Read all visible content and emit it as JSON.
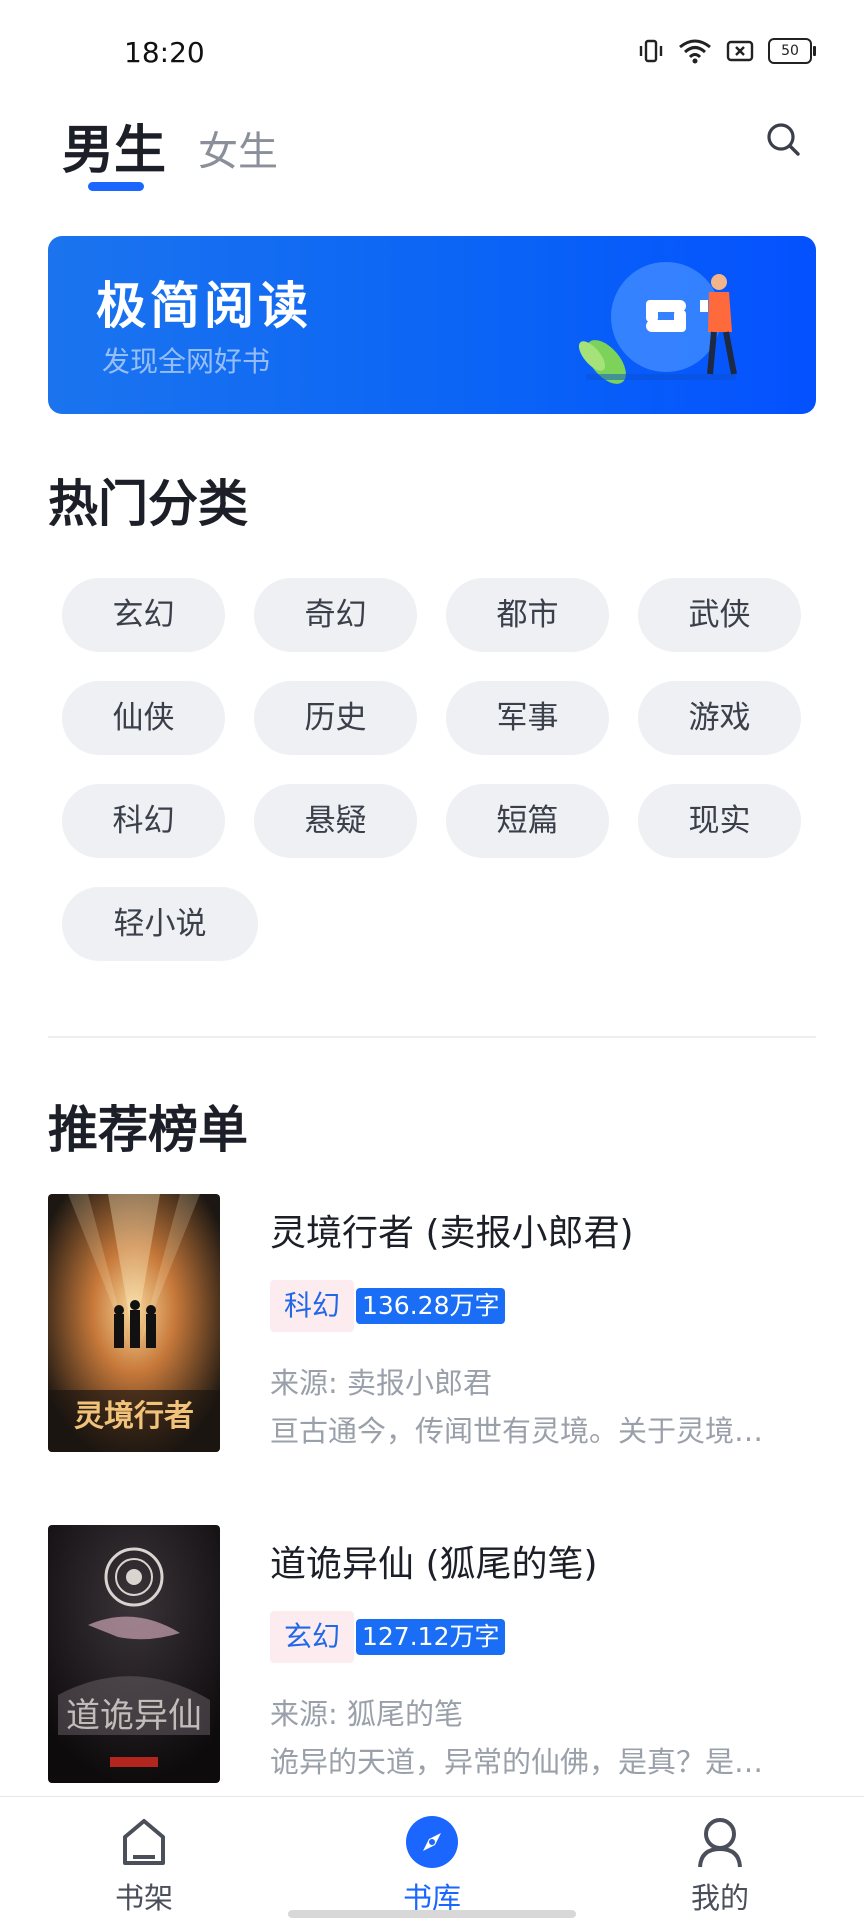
{
  "status_bar": {
    "time": "18:20",
    "icons": [
      "vibrate-icon",
      "wifi-icon",
      "sim-off-icon",
      "battery-icon"
    ],
    "battery": "50"
  },
  "header": {
    "tabs": [
      {
        "label": "男生",
        "active": true
      },
      {
        "label": "女生",
        "active": false
      }
    ],
    "search_icon": "search-icon"
  },
  "banner": {
    "title": "极简阅读",
    "subtitle": "发现全网好书"
  },
  "categories": {
    "title": "热门分类",
    "items": [
      "玄幻",
      "奇幻",
      "都市",
      "武侠",
      "仙侠",
      "历史",
      "军事",
      "游戏",
      "科幻",
      "悬疑",
      "短篇",
      "现实",
      "轻小说"
    ]
  },
  "recommend": {
    "title": "推荐榜单",
    "books": [
      {
        "title": "灵境行者 (卖报小郎君)",
        "category": "科幻",
        "words": "136.28万字",
        "source": "来源: 卖报小郎君",
        "desc": "亘古通今，传闻世有灵境。关于灵境…",
        "cover_text": "灵境行者"
      },
      {
        "title": "道诡异仙 (狐尾的笔)",
        "category": "玄幻",
        "words": "127.12万字",
        "source": "来源: 狐尾的笔",
        "desc": "诡异的天道，异常的仙佛，是真？是…",
        "cover_text": "道诡异仙"
      }
    ]
  },
  "bottom_nav": {
    "items": [
      {
        "label": "书架",
        "icon": "bookshelf-icon",
        "active": false
      },
      {
        "label": "书库",
        "icon": "compass-icon",
        "active": true
      },
      {
        "label": "我的",
        "icon": "profile-icon",
        "active": false
      }
    ]
  },
  "colors": {
    "accent": "#1a66ff",
    "chip_bg": "#eef0f4",
    "tag_pink": "#fdecef"
  }
}
